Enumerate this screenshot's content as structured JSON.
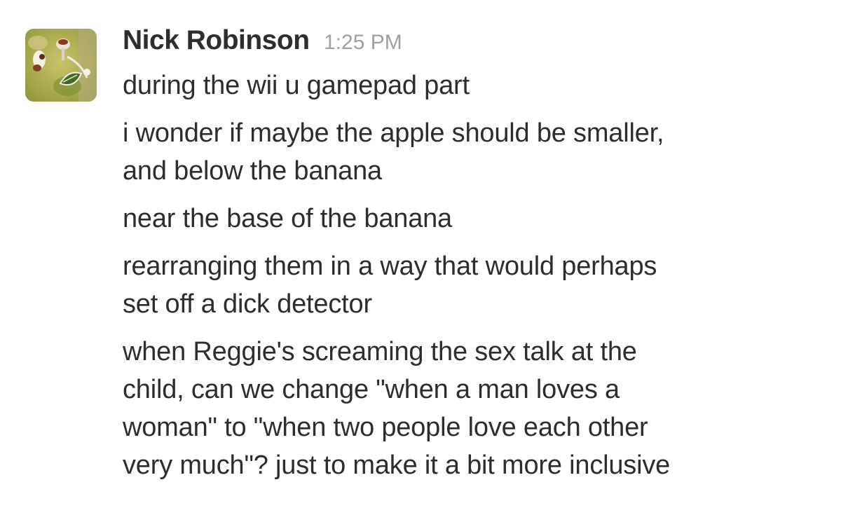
{
  "message": {
    "sender_name": "Nick Robinson",
    "timestamp": "1:25 PM",
    "avatar_icon": "fruit-avatar-icon",
    "lines": [
      "during the wii u gamepad part",
      "i wonder if maybe the apple should be smaller,\nand below the banana",
      "near the base of the banana",
      "rearranging them in a way that would perhaps\nset off a dick detector",
      "when Reggie's screaming the sex talk at the\nchild, can we change \"when a man loves a\nwoman\" to \"when two people love each other\nvery much\"? just to make it a bit more inclusive"
    ]
  },
  "colors": {
    "text": "#2c2d30",
    "timestamp": "#a0a0a2",
    "avatar_background": "#b7b65a"
  }
}
